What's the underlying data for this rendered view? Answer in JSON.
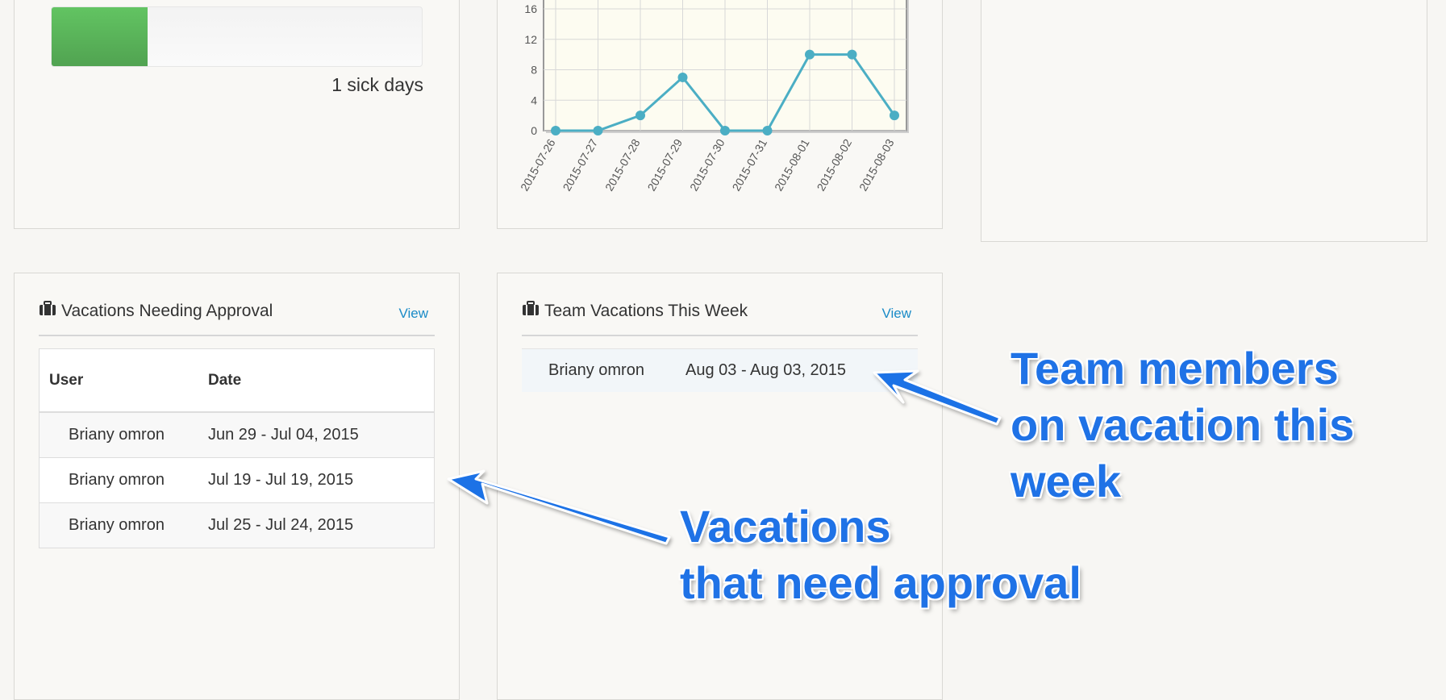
{
  "sick_days": {
    "label": "1  sick days",
    "progress_fraction": 0.26,
    "colors": {
      "fill": "#5cb85c",
      "track": "#f5f5f5"
    }
  },
  "chart_data": {
    "type": "line",
    "x": [
      "2015-07-26",
      "2015-07-27",
      "2015-07-28",
      "2015-07-29",
      "2015-07-30",
      "2015-07-31",
      "2015-08-01",
      "2015-08-02",
      "2015-08-03"
    ],
    "series": [
      {
        "values": [
          0,
          0,
          2,
          7,
          0,
          0,
          10,
          10,
          2
        ]
      }
    ],
    "y_ticks": [
      "0",
      "4",
      "8",
      "12",
      "16"
    ],
    "ylim": [
      0,
      16
    ],
    "grid": true,
    "colors": {
      "line": "#4baec4",
      "plot_bg": "#fdfcf1",
      "grid": "#d8d8d8"
    }
  },
  "approval": {
    "title": "Vacations Needing Approval",
    "view_label": "View",
    "columns": [
      "User",
      "Date"
    ],
    "rows": [
      {
        "user": "Briany omron",
        "date": "Jun 29 - Jul 04, 2015"
      },
      {
        "user": "Briany omron",
        "date": "Jul 19 - Jul 19, 2015"
      },
      {
        "user": "Briany omron",
        "date": "Jul 25 - Jul 24, 2015"
      }
    ]
  },
  "team": {
    "title": "Team Vacations This Week",
    "view_label": "View",
    "rows": [
      {
        "user": "Briany omron",
        "date": "Aug 03 - Aug 03, 2015"
      }
    ]
  },
  "annotations": {
    "team_note": [
      "Team members",
      "on vacation this",
      "week"
    ],
    "approval_note": [
      "Vacations",
      "that need approval"
    ],
    "color": "#1f72e6"
  },
  "icons": {
    "briefcase": "briefcase-icon"
  }
}
